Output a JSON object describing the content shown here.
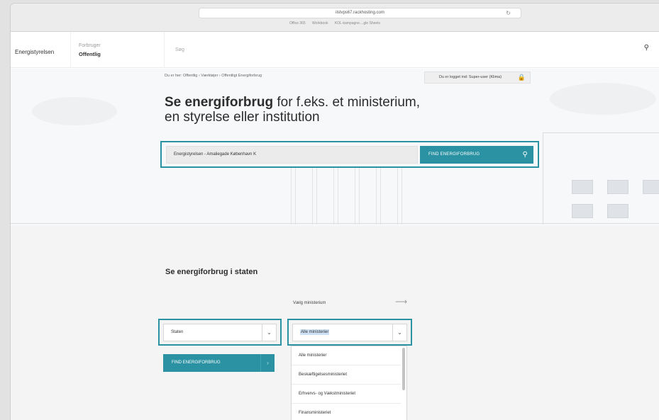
{
  "browser": {
    "url": "ilstvps67.rackhosting.com",
    "bookmarks": [
      "Office 365",
      "Workbook",
      "KOL-kampagne....gle Sheets"
    ]
  },
  "header": {
    "brand": "Energistyrelsen",
    "user_caption": "Forbruger",
    "user_role": "Offentlig",
    "search_placeholder": "Søg"
  },
  "hero": {
    "breadcrumb": "Du er her:  Offentlig  ›  Værktøjer  ›  Offentligt Energiforbrug",
    "login_status": "Du er logget ind: Super-user (Klima)",
    "title_bold": "Se energiforbrug",
    "title_rest_line1": " for f.eks. et ministerium,",
    "title_line2": "en styrelse eller institution",
    "search_value": "Energistyrelsen - Amaliegade København K",
    "find_button": "FIND ENERGIFORBRUG"
  },
  "state_section": {
    "title": "Se energiforbrug i staten",
    "choose_label": "Vælg ministerium",
    "left_select_value": "Staten",
    "find_button": "FIND ENERGIFORBRUG",
    "right_select_value": "Alle ministerier",
    "dropdown_options": [
      "Alle ministerier",
      "Beskæftigelsesministeriet",
      "Erhvervs- og Vækstministeriet",
      "Finansministeriet"
    ]
  },
  "icons": {
    "search": "magnifier",
    "lock": "padlock",
    "arrow": "arrow-right",
    "chevron": "chevron-down"
  },
  "colors": {
    "accent": "#2a92a2",
    "selection": "#cde2f7"
  }
}
